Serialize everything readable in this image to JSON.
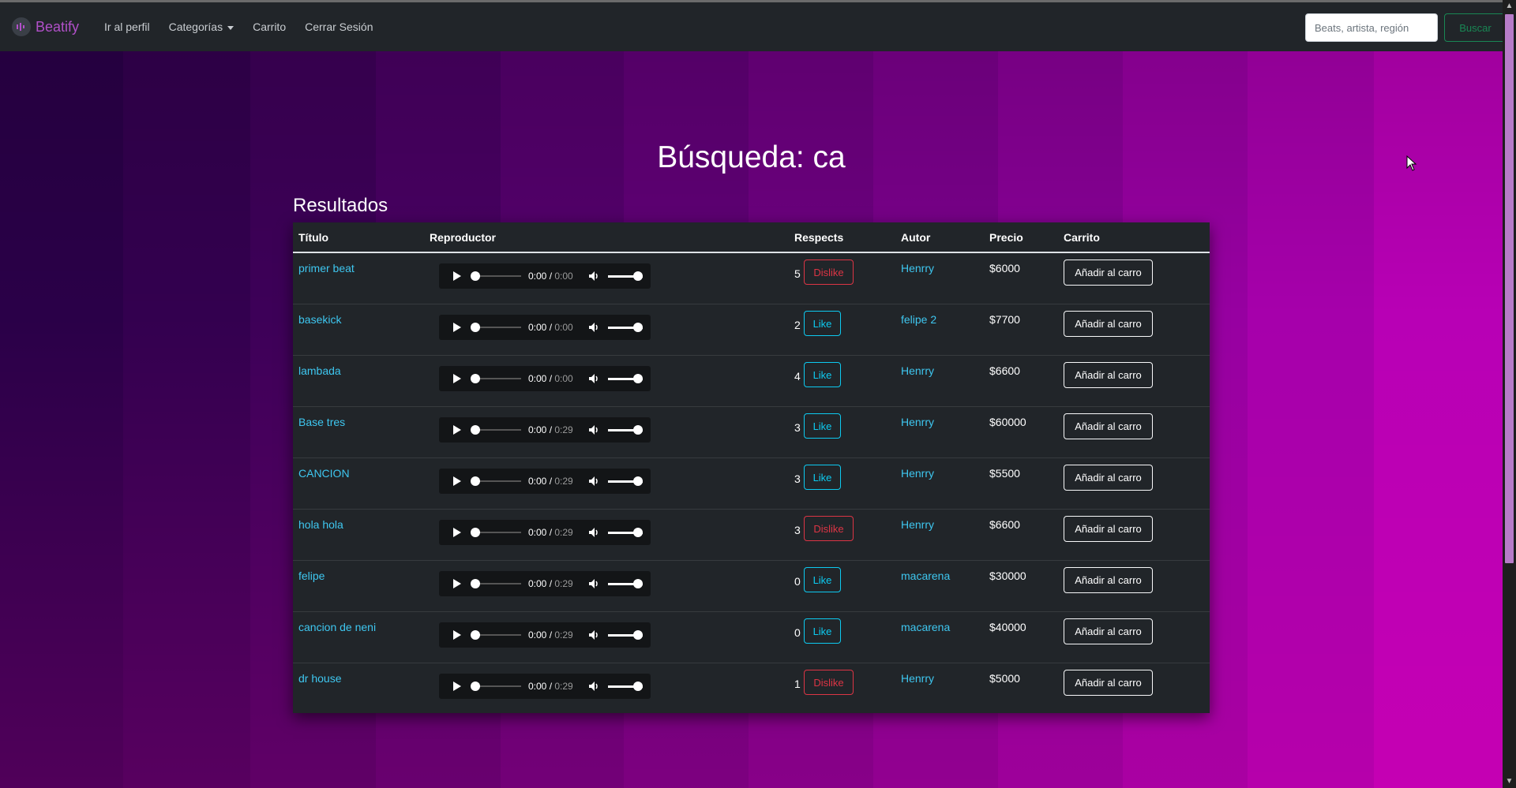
{
  "navbar": {
    "brand": "Beatify",
    "links": [
      "Ir al perfil",
      "Categorías",
      "Carrito",
      "Cerrar Sesión"
    ],
    "search_placeholder": "Beats, artista, región",
    "search_button": "Buscar"
  },
  "page": {
    "title": "Búsqueda: ca",
    "results_heading": "Resultados"
  },
  "table": {
    "headers": [
      "Título",
      "Reproductor",
      "Respects",
      "Autor",
      "Precio",
      "Carrito"
    ],
    "rows": [
      {
        "title": "primer beat",
        "time": "0:00",
        "duration": "0:00",
        "respects": "5",
        "vote": "Dislike",
        "author": "Henrry",
        "price": "$6000",
        "cart": "Añadir al carro"
      },
      {
        "title": "basekick",
        "time": "0:00",
        "duration": "0:00",
        "respects": "2",
        "vote": "Like",
        "author": "felipe 2",
        "price": "$7700",
        "cart": "Añadir al carro"
      },
      {
        "title": "lambada",
        "time": "0:00",
        "duration": "0:00",
        "respects": "4",
        "vote": "Like",
        "author": "Henrry",
        "price": "$6600",
        "cart": "Añadir al carro"
      },
      {
        "title": "Base tres",
        "time": "0:00",
        "duration": "0:29",
        "respects": "3",
        "vote": "Like",
        "author": "Henrry",
        "price": "$60000",
        "cart": "Añadir al carro"
      },
      {
        "title": "CANCION",
        "time": "0:00",
        "duration": "0:29",
        "respects": "3",
        "vote": "Like",
        "author": "Henrry",
        "price": "$5500",
        "cart": "Añadir al carro"
      },
      {
        "title": "hola hola",
        "time": "0:00",
        "duration": "0:29",
        "respects": "3",
        "vote": "Dislike",
        "author": "Henrry",
        "price": "$6600",
        "cart": "Añadir al carro"
      },
      {
        "title": "felipe",
        "time": "0:00",
        "duration": "0:29",
        "respects": "0",
        "vote": "Like",
        "author": "macarena",
        "price": "$30000",
        "cart": "Añadir al carro"
      },
      {
        "title": "cancion de neni",
        "time": "0:00",
        "duration": "0:29",
        "respects": "0",
        "vote": "Like",
        "author": "macarena",
        "price": "$40000",
        "cart": "Añadir al carro"
      },
      {
        "title": "dr house",
        "time": "0:00",
        "duration": "0:29",
        "respects": "1",
        "vote": "Dislike",
        "author": "Henrry",
        "price": "$5000",
        "cart": "Añadir al carro"
      }
    ]
  },
  "colors": {
    "navbar": "#212529",
    "brand": "#b150c9",
    "link": "#3ec7f0",
    "like": "#0dcaf0",
    "dislike": "#dc3545",
    "search_button": "#198754"
  }
}
